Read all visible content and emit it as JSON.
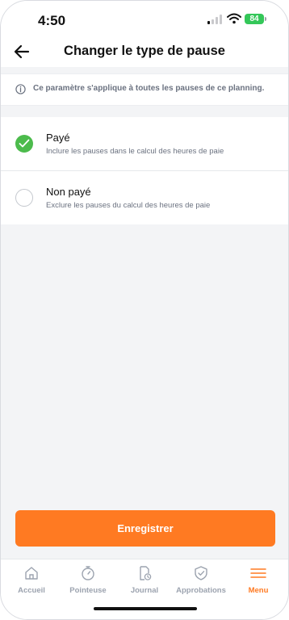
{
  "status_bar": {
    "time": "4:50",
    "battery": "84"
  },
  "header": {
    "title": "Changer le type de pause"
  },
  "info": {
    "text": "Ce paramètre s'applique à toutes les pauses de ce planning."
  },
  "options": [
    {
      "title": "Payé",
      "description": "Inclure les pauses dans le calcul des heures de paie",
      "selected": true
    },
    {
      "title": "Non payé",
      "description": "Exclure les pauses du calcul des heures de paie",
      "selected": false
    }
  ],
  "save_button": {
    "label": "Enregistrer"
  },
  "tabs": [
    {
      "label": "Accueil",
      "icon": "home-icon",
      "active": false
    },
    {
      "label": "Pointeuse",
      "icon": "stopwatch-icon",
      "active": false
    },
    {
      "label": "Journal",
      "icon": "journal-icon",
      "active": false
    },
    {
      "label": "Approbations",
      "icon": "shield-check-icon",
      "active": false
    },
    {
      "label": "Menu",
      "icon": "menu-icon",
      "active": true
    }
  ],
  "colors": {
    "accent": "#ff7a22",
    "selected": "#4cbb4c",
    "battery": "#34c759"
  }
}
